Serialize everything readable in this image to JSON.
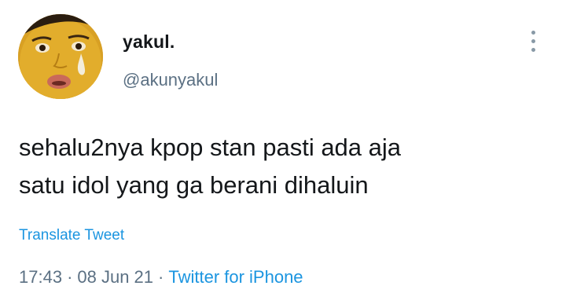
{
  "user": {
    "display_name": "yakul.",
    "handle": "@akunyakul"
  },
  "tweet": {
    "lines": [
      "sehalu2nya kpop stan pasti ada aja",
      "satu idol yang ga berani dihaluin"
    ],
    "translate_label": "Translate Tweet",
    "time": "17:43",
    "separator": "·",
    "date": "08 Jun 21",
    "source": "Twitter for iPhone"
  },
  "icons": {
    "more": "more-vertical-icon"
  },
  "colors": {
    "link": "#1b95e0",
    "muted": "#5b7083",
    "text": "#14171a",
    "avatar_bg": "#d9a125"
  }
}
